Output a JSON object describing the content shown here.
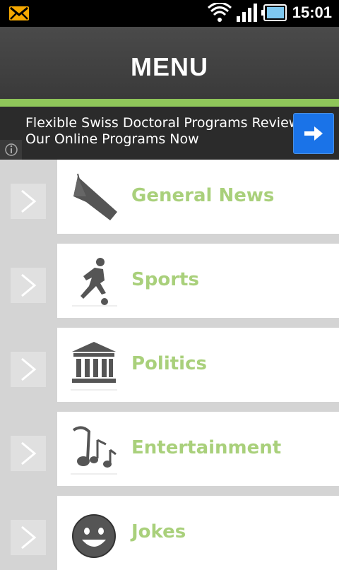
{
  "status_bar": {
    "time": "15:01",
    "icons": [
      "mail-icon",
      "wifi-icon",
      "signal-icon",
      "battery-icon"
    ]
  },
  "header": {
    "title": "MENU"
  },
  "ad": {
    "line1": "Flexible Swiss Doctoral Programs Review",
    "line2": "Our Online Programs Now",
    "button_icon": "arrow-right-icon",
    "info_icon": "info-icon"
  },
  "menu": {
    "items": [
      {
        "label": "General News",
        "icon": "megaphone-icon"
      },
      {
        "label": "Sports",
        "icon": "soccer-player-icon"
      },
      {
        "label": "Politics",
        "icon": "government-building-icon"
      },
      {
        "label": "Entertainment",
        "icon": "music-notes-icon"
      },
      {
        "label": "Jokes",
        "icon": "smiley-face-icon"
      }
    ]
  },
  "colors": {
    "accent_green": "#8fc65a",
    "label_green": "#a9d07b",
    "header_dark": "#3f3f3f",
    "ad_button_blue": "#1a73e8"
  }
}
